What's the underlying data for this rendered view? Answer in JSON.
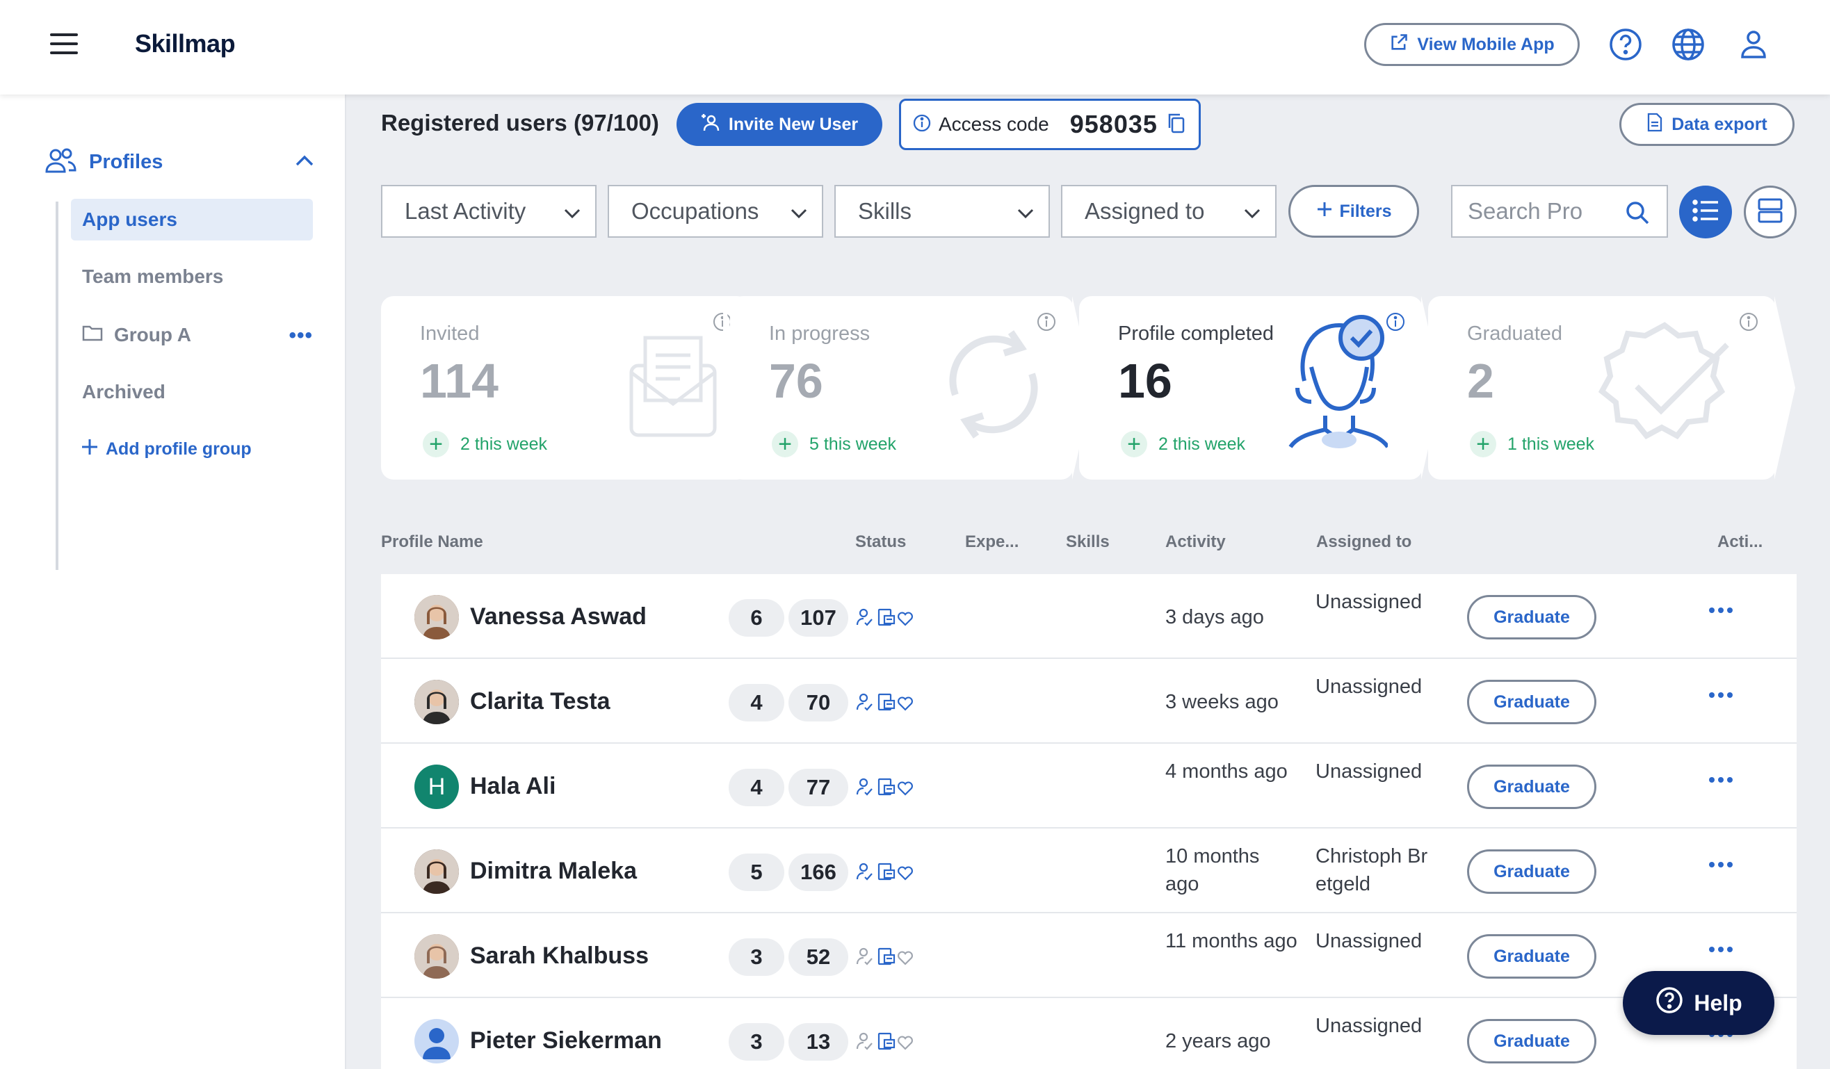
{
  "header": {
    "logo": "Skillmap",
    "view_mobile_label": "View Mobile App",
    "icons": [
      "menu-icon",
      "external-link-icon",
      "help-circle-icon",
      "globe-icon",
      "user-icon"
    ]
  },
  "sidebar": {
    "profiles_label": "Profiles",
    "items": [
      {
        "label": "App users",
        "active": true
      },
      {
        "label": "Team members",
        "active": false
      },
      {
        "label": "Group A",
        "active": false,
        "icon": "folder-icon"
      },
      {
        "label": "Archived",
        "active": false
      }
    ],
    "add_group_label": "Add profile group"
  },
  "toolbar": {
    "title": "Registered users (97/100)",
    "invite_label": "Invite New User",
    "access_label": "Access code",
    "access_code": "958035",
    "data_export_label": "Data export",
    "filters": [
      "Last Activity",
      "Occupations",
      "Skills",
      "Assigned to"
    ],
    "filters_button": "Filters",
    "search_placeholder": "Search Pro"
  },
  "stats": [
    {
      "label": "Invited",
      "value": "114",
      "week": "2 this week",
      "active": false
    },
    {
      "label": "In progress",
      "value": "76",
      "week": "5 this week",
      "active": false
    },
    {
      "label": "Profile completed",
      "value": "16",
      "week": "2 this week",
      "active": true
    },
    {
      "label": "Graduated",
      "value": "2",
      "week": "1 this week",
      "active": false
    }
  ],
  "table": {
    "columns": [
      "Profile Name",
      "Status",
      "Expe...",
      "Skills",
      "Activity",
      "Assigned to",
      "Acti..."
    ],
    "graduate_label": "Graduate",
    "rows": [
      {
        "name": "Vanessa Aswad",
        "experience": "6",
        "skills": "107",
        "activity": "3 days ago",
        "assigned": "Unassigned",
        "avatar": "photo",
        "avatar_color": "#8a5a3c"
      },
      {
        "name": "Clarita Testa",
        "experience": "4",
        "skills": "70",
        "activity": "3 weeks ago",
        "assigned": "Unassigned",
        "avatar": "photo",
        "avatar_color": "#2b2b2b"
      },
      {
        "name": "Hala Ali",
        "experience": "4",
        "skills": "77",
        "activity": "4 months ago",
        "assigned": "Unassigned",
        "avatar": "initial",
        "initial": "H",
        "avatar_color": "#11856e"
      },
      {
        "name": "Dimitra Maleka",
        "experience": "5",
        "skills": "166",
        "activity": "10 months ago",
        "assigned": "Christoph Bretgeld",
        "avatar": "photo",
        "avatar_color": "#3b2a22"
      },
      {
        "name": "Sarah Khalbuss",
        "experience": "3",
        "skills": "52",
        "activity": "11 months ago",
        "assigned": "Unassigned",
        "avatar": "photo",
        "avatar_color": "#8f6a55"
      },
      {
        "name": "Pieter Siekerman",
        "experience": "3",
        "skills": "13",
        "activity": "2 years ago",
        "assigned": "Unassigned",
        "avatar": "placeholder",
        "avatar_color": "#c9daf5"
      }
    ]
  },
  "help_label": "Help",
  "colors": {
    "accent": "#2a66c9",
    "success": "#23a36a",
    "dark": "#0b1a4a"
  }
}
